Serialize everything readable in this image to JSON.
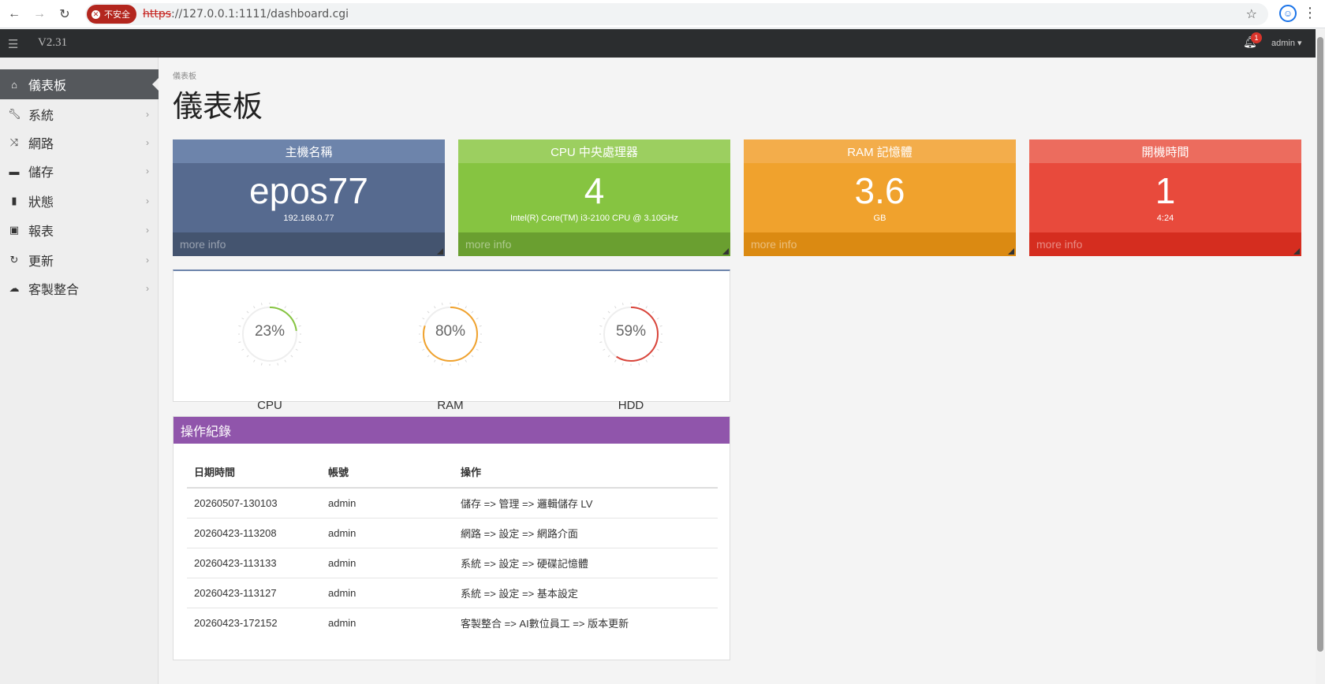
{
  "browser": {
    "insecure_label": "不安全",
    "url_scheme": "https",
    "url_rest": "://127.0.0.1:1111/dashboard.cgi"
  },
  "topbar": {
    "version": "V2.31",
    "notification_count": "1",
    "user": "admin"
  },
  "sidebar": {
    "items": [
      {
        "label": "儀表板",
        "icon": "home-icon",
        "active": true
      },
      {
        "label": "系統",
        "icon": "wrench-icon"
      },
      {
        "label": "網路",
        "icon": "shuffle-icon"
      },
      {
        "label": "儲存",
        "icon": "hdd-icon"
      },
      {
        "label": "狀態",
        "icon": "bar-chart-icon"
      },
      {
        "label": "報表",
        "icon": "picture-icon"
      },
      {
        "label": "更新",
        "icon": "refresh-icon"
      },
      {
        "label": "客製整合",
        "icon": "cloud-icon"
      }
    ]
  },
  "page": {
    "breadcrumb": "儀表板",
    "title": "儀表板"
  },
  "stats": [
    {
      "title": "主機名稱",
      "value": "epos77",
      "sub": "192.168.0.77",
      "more": "more info",
      "head": "#6d84ab",
      "body": "#566a8f",
      "foot": "#44546f"
    },
    {
      "title": "CPU 中央處理器",
      "value": "4",
      "sub": "Intel(R) Core(TM) i3-2100 CPU @ 3.10GHz",
      "more": "more info",
      "head": "#9ccf60",
      "body": "#86c441",
      "foot": "#6a9f30"
    },
    {
      "title": "RAM 記憶體",
      "value": "3.6",
      "sub": "GB",
      "more": "more info",
      "head": "#f3ad4b",
      "body": "#f0a22d",
      "foot": "#db8a12"
    },
    {
      "title": "開機時間",
      "value": "1",
      "sub": "4:24",
      "more": "more info",
      "head": "#ec6c5e",
      "body": "#e84a3c",
      "foot": "#d52d1f"
    }
  ],
  "gauges": [
    {
      "label": "CPU",
      "percent": 23,
      "percent_text": "23%",
      "color": "#86c441"
    },
    {
      "label": "RAM",
      "percent": 80,
      "percent_text": "80%",
      "color": "#f0a22d"
    },
    {
      "label": "HDD",
      "percent": 59,
      "percent_text": "59%",
      "color": "#d9443a"
    }
  ],
  "log": {
    "title": "操作紀錄",
    "columns": [
      "日期時間",
      "帳號",
      "操作"
    ],
    "rows": [
      [
        "20260507-130103",
        "admin",
        "儲存 => 管理 => 邏輯儲存 LV"
      ],
      [
        "20260423-113208",
        "admin",
        "網路 => 設定 => 網路介面"
      ],
      [
        "20260423-113133",
        "admin",
        "系統 => 設定 => 硬碟記憶體"
      ],
      [
        "20260423-113127",
        "admin",
        "系統 => 設定 => 基本設定"
      ],
      [
        "20260423-172152",
        "admin",
        "客製整合 => AI數位員工 => 版本更新"
      ]
    ]
  }
}
